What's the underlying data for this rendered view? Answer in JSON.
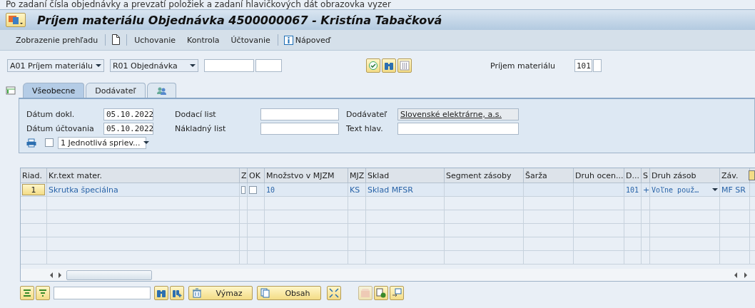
{
  "document_text": "Po zadaní čísla objednávky a prevzatí položiek a zadaní hlavičkových dát obrazovka vyzer",
  "window": {
    "title": "Príjem materiálu Objednávka 4500000067 - Kristína Tabačková"
  },
  "toolbar": [
    {
      "kind": "text",
      "label": "Zobrazenie prehľadu"
    },
    {
      "kind": "icon"
    },
    {
      "kind": "text",
      "label": "Uchovanie"
    },
    {
      "kind": "text",
      "label": "Kontrola"
    },
    {
      "kind": "text",
      "label": "Účtovanie"
    },
    {
      "kind": "info",
      "label": "Nápoveď"
    }
  ],
  "selection": {
    "action": "A01 Príjem materiálu",
    "reference": "R01 Objednávka",
    "movement_label": "Príjem materiálu",
    "movement_type": "101"
  },
  "tabs": [
    {
      "kind": "text",
      "label": "Všeobecne",
      "selected": true
    },
    {
      "kind": "text",
      "label": "Dodávateľ",
      "selected": false
    },
    {
      "kind": "icon",
      "selected": false
    }
  ],
  "header": {
    "columns": [
      [
        {
          "label": "Dátum dokl.",
          "value": "05.10.2022",
          "readonly": false
        },
        {
          "label": "Dátum účtovania",
          "value": "05.10.2022",
          "readonly": false
        }
      ],
      [
        {
          "label": "Dodací list",
          "readonly": false
        },
        {
          "label": "Nákladný list",
          "readonly": false
        }
      ],
      [
        {
          "label": "Dodávateľ",
          "value": "Slovenské elektrárne, a.s.",
          "readonly": true
        },
        {
          "label": "Text hlav.",
          "readonly": false
        }
      ]
    ],
    "print_checked": false,
    "print_option": "1 Jednotlivá spriev..."
  },
  "table": {
    "columns": [
      "Riad.",
      "Kr.text mater.",
      "Z",
      "OK",
      "Množstvo v MJZM",
      "MJZ",
      "Sklad",
      "Segment zásoby",
      "Šarža",
      "Druh ocen...",
      "D...",
      "S",
      "Druh zásob",
      "Záv."
    ],
    "rows": [
      {
        "cells": [
          {
            "kind": "button",
            "value": "1"
          },
          {
            "kind": "text",
            "value": "Skrutka špeciálna"
          },
          {
            "kind": "checkbox",
            "checked": false
          },
          {
            "kind": "checkbox",
            "checked": false
          },
          {
            "kind": "text",
            "value": "10"
          },
          {
            "kind": "text",
            "value": "KS"
          },
          {
            "kind": "text",
            "value": "Sklad MFSR"
          },
          {
            "kind": "blank"
          },
          {
            "kind": "blank"
          },
          {
            "kind": "blank"
          },
          {
            "kind": "text",
            "value": "101"
          },
          {
            "kind": "text",
            "value": "+"
          },
          {
            "kind": "select",
            "value": "Voľne použ…"
          },
          {
            "kind": "text",
            "value": "MF SR"
          }
        ]
      }
    ]
  },
  "bottom_buttons": [
    {
      "label": "Výmaz"
    },
    {
      "label": "Obsah"
    }
  ]
}
